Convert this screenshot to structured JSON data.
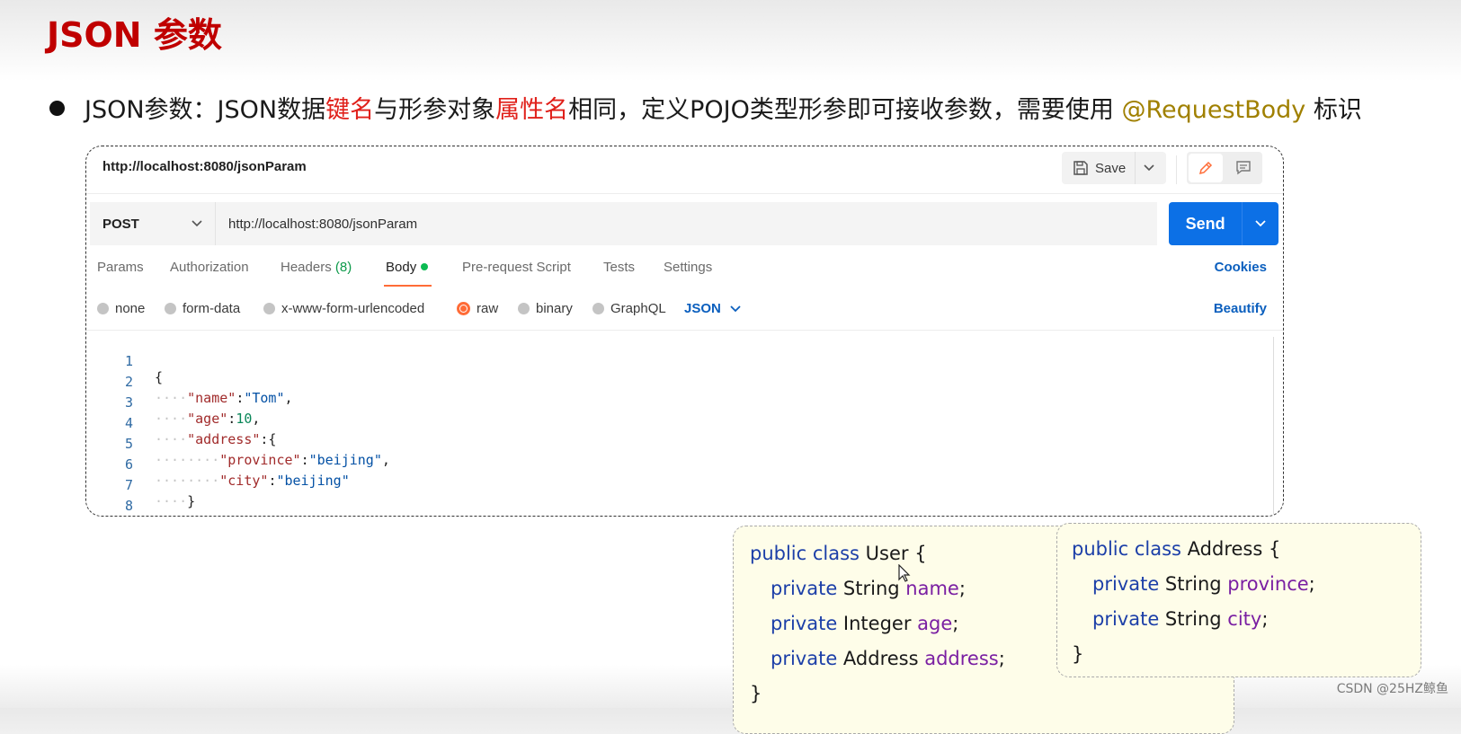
{
  "slide": {
    "title": "JSON 参数",
    "bullet": {
      "part1": "JSON参数：JSON数据",
      "hl1": "键名",
      "part2": "与形参对象",
      "hl2": "属性名",
      "part3": "相同，定义POJO类型形参即可接收参数，需要使用 ",
      "annotation": "@RequestBody",
      "part4": " 标识"
    }
  },
  "postman": {
    "tab_title": "http://localhost:8080/jsonParam",
    "save_label": "Save",
    "method": "POST",
    "url": "http://localhost:8080/jsonParam",
    "send_label": "Send",
    "tabs": {
      "params": "Params",
      "authorization": "Authorization",
      "headers": "Headers",
      "headers_count": "(8)",
      "body": "Body",
      "prerequest": "Pre-request Script",
      "tests": "Tests",
      "settings": "Settings"
    },
    "cookies_label": "Cookies",
    "body_types": {
      "none": "none",
      "form_data": "form-data",
      "urlencoded": "x-www-form-urlencoded",
      "raw": "raw",
      "binary": "binary",
      "graphql": "GraphQL"
    },
    "selected_body_type": "raw",
    "format": "JSON",
    "beautify_label": "Beautify",
    "code": {
      "line_numbers": [
        "1",
        "2",
        "3",
        "4",
        "5",
        "6",
        "7",
        "8"
      ],
      "l1_open": "{",
      "l2_key": "\"name\"",
      "l2_val": "\"Tom\"",
      "l3_key": "\"age\"",
      "l3_val": "10",
      "l4_key": "\"address\"",
      "l4_open": ":{",
      "l5_key": "\"province\"",
      "l5_val": "\"beijing\"",
      "l6_key": "\"city\"",
      "l6_val": "\"beijing\"",
      "l7_close": "}",
      "l8_close": "}"
    }
  },
  "user_class": {
    "header_kw": "public class",
    "header_name": " User {",
    "f1_kw": "private",
    "f1_type": " String ",
    "f1_name": "name",
    "f2_kw": "private",
    "f2_type": " Integer ",
    "f2_name": "age",
    "f3_kw": "private",
    "f3_type": " Address ",
    "f3_name": "address",
    "close": "}"
  },
  "address_class": {
    "header_kw": "public class",
    "header_name": " Address {",
    "f1_kw": "private",
    "f1_type": " String ",
    "f1_name": "province",
    "f2_kw": "private",
    "f2_type": " String ",
    "f2_name": "city",
    "close": "}"
  },
  "watermark": "CSDN @25HZ鲸鱼",
  "colors": {
    "title_red": "#c00000",
    "highlight_red": "#e0201a",
    "annotation_olive": "#a08000",
    "send_blue": "#0c70e6",
    "active_tab_orange": "#ff6c37",
    "body_dot_green": "#0cbb52"
  }
}
